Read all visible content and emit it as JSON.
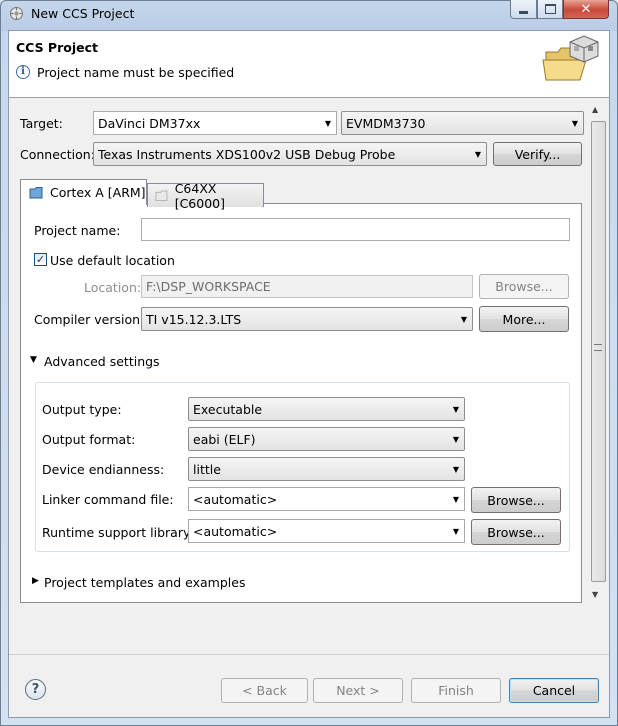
{
  "window": {
    "title": "New CCS Project",
    "app_icon": "ccs-icon"
  },
  "header": {
    "title": "CCS Project",
    "message": "Project name must be specified",
    "message_icon": "info-icon",
    "banner_icon": "folder-wizard-icon"
  },
  "target": {
    "label": "Target:",
    "device": "DaVinci DM37xx",
    "board": "EVMDM3730"
  },
  "connection": {
    "label": "Connection:",
    "value": "Texas Instruments XDS100v2 USB Debug Probe",
    "verify_label": "Verify..."
  },
  "tabs": [
    {
      "label": "Cortex A [ARM]",
      "active": true
    },
    {
      "label": "C64XX [C6000]",
      "active": false
    }
  ],
  "form": {
    "project_name_label": "Project name:",
    "project_name_value": "",
    "use_default_label": "Use default location",
    "use_default_checked": true,
    "location_label": "Location:",
    "location_value": "F:\\DSP_WORKSPACE",
    "browse_label": "Browse...",
    "compiler_label": "Compiler version:",
    "compiler_value": "TI v15.12.3.LTS",
    "more_label": "More..."
  },
  "advanced": {
    "label": "Advanced settings",
    "output_type_label": "Output type:",
    "output_type_value": "Executable",
    "output_format_label": "Output format:",
    "output_format_value": "eabi (ELF)",
    "endianness_label": "Device endianness:",
    "endianness_value": "little",
    "linker_label": "Linker command file:",
    "linker_value": "<automatic>",
    "runtime_label": "Runtime support library:",
    "runtime_value": "<automatic>",
    "browse_label": "Browse..."
  },
  "templates": {
    "label": "Project templates and examples"
  },
  "footer": {
    "back": "< Back",
    "next": "Next >",
    "finish": "Finish",
    "cancel": "Cancel"
  }
}
